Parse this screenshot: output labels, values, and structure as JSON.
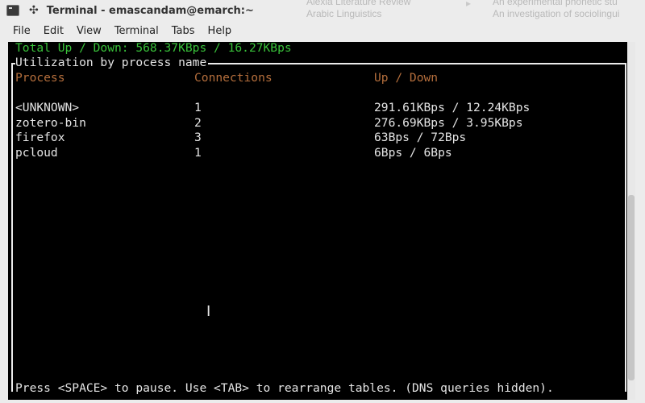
{
  "background_app": {
    "items_left": [
      "Alexia Literature Review",
      "Arabic Linguistics"
    ],
    "items_right": [
      "An experimental phonetic stu",
      "An investigation of sociolingui"
    ],
    "separator": "▸"
  },
  "window": {
    "title": "Terminal - emascandam@emarch:~",
    "pin_glyph": "✣"
  },
  "menubar": {
    "items": [
      "File",
      "Edit",
      "View",
      "Terminal",
      "Tabs",
      "Help"
    ]
  },
  "terminal": {
    "total_line": "Total Up / Down: 568.37KBps / 16.27KBps",
    "box_title": "Utilization by process name",
    "columns": [
      "Process",
      "Connections",
      "Up / Down"
    ],
    "rows": [
      {
        "process": "<UNKNOWN>",
        "connections": "1",
        "updown": "291.61KBps / 12.24KBps"
      },
      {
        "process": "zotero-bin",
        "connections": "2",
        "updown": "276.69KBps / 3.95KBps"
      },
      {
        "process": "firefox",
        "connections": "3",
        "updown": "63Bps / 72Bps"
      },
      {
        "process": "pcloud",
        "connections": "1",
        "updown": "6Bps / 6Bps"
      }
    ],
    "footer": "Press <SPACE> to pause. Use <TAB> to rearrange tables. (DNS queries hidden).",
    "cursor_glyph": "I"
  },
  "colors": {
    "terminal_bg": "#000000",
    "total_green": "#39c23a",
    "header_orange": "#b46e3c",
    "text": "#e4e4e4"
  }
}
